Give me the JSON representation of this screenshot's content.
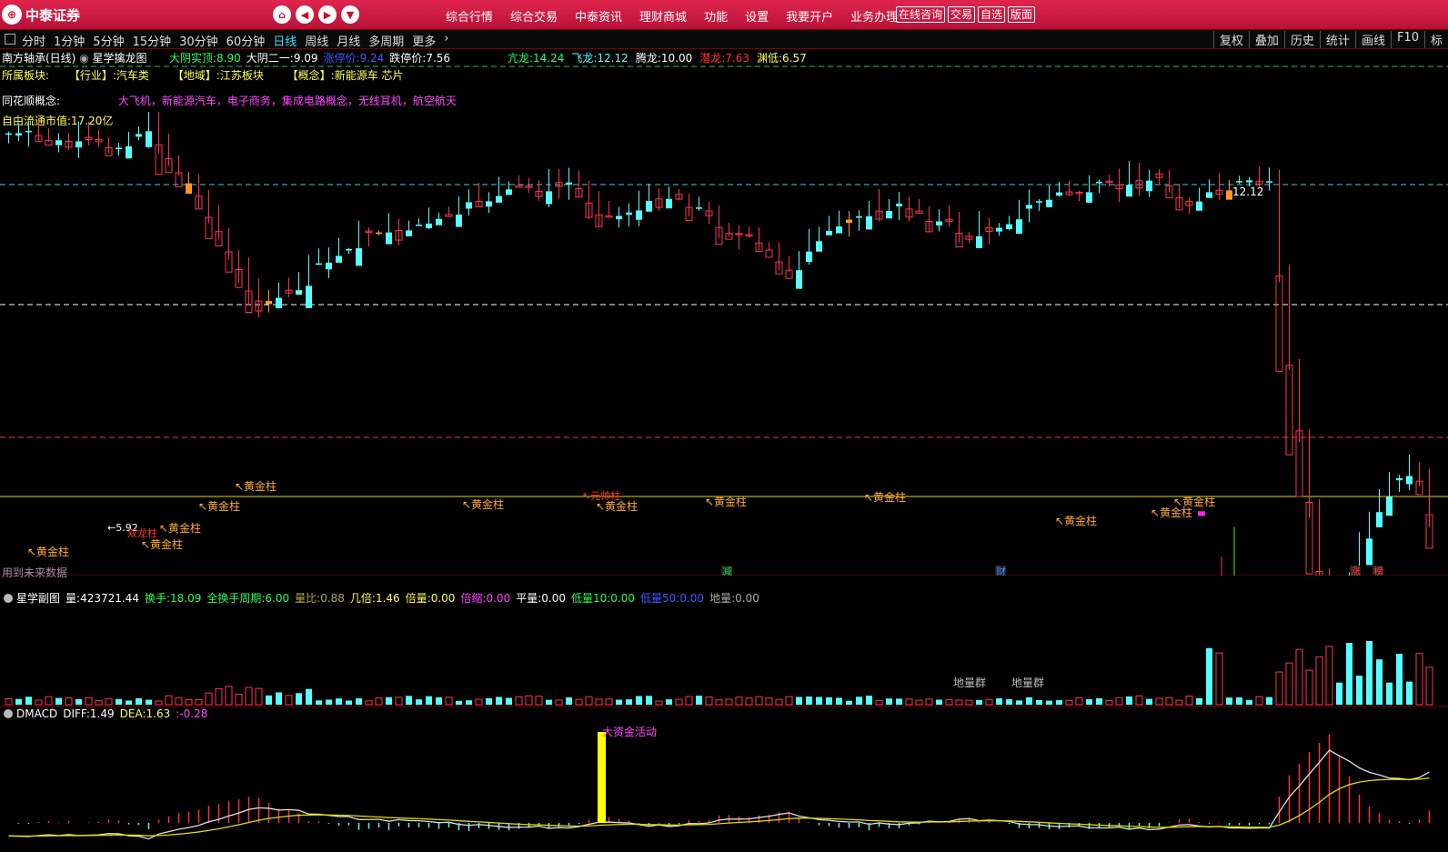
{
  "brand": "中泰证券",
  "nav_menu": [
    "综合行情",
    "综合交易",
    "中泰资讯",
    "理财商城",
    "功能",
    "设置",
    "我要开户",
    "业务办理"
  ],
  "top_buttons": [
    "在线咨询",
    "交易",
    "自选",
    "版面"
  ],
  "periods": [
    "分时",
    "1分钟",
    "5分钟",
    "15分钟",
    "30分钟",
    "60分钟",
    "日线",
    "周线",
    "月线",
    "多周期",
    "更多"
  ],
  "active_period": "日线",
  "right_tools": [
    "复权",
    "叠加",
    "历史",
    "统计",
    "画线",
    "F10",
    "标"
  ],
  "header": {
    "stock": "南方轴承(日线)",
    "indicator": "星学擒龙图",
    "items": [
      {
        "label": "大阴实顶:",
        "value": "8.90",
        "color": "green"
      },
      {
        "label": "大阴二一:",
        "value": "9.09",
        "color": "white"
      },
      {
        "label": "涨停价:",
        "value": "9.24",
        "color": "blue"
      },
      {
        "label": "跌停价:",
        "value": "7.56",
        "color": "white"
      }
    ],
    "dragons": [
      {
        "label": "亢龙:",
        "value": "14.24",
        "color": "green"
      },
      {
        "label": "飞龙:",
        "value": "12.12",
        "color": "cyan"
      },
      {
        "label": "腾龙:",
        "value": "10.00",
        "color": "white"
      },
      {
        "label": "潜龙:",
        "value": "7.63",
        "color": "red"
      },
      {
        "label": "渊低:",
        "value": "6.57",
        "color": "yellow"
      }
    ]
  },
  "sector": {
    "label": "所属板块:",
    "industry_label": "【行业】:",
    "industry": "汽车类",
    "region_label": "【地域】:",
    "region": "江苏板块",
    "concept_label": "【概念】:",
    "concept": "新能源车 芯片"
  },
  "ths": {
    "label": "同花顺概念:",
    "value": "大飞机，新能源汽车，电子商务，集成电路概念，无线耳机，航空航天"
  },
  "float_cap": {
    "label": "自由流通市值:",
    "value": "17.20亿"
  },
  "price_high_label": "12.12",
  "future_note": "用到未来数据",
  "signal_label": "黄金柱",
  "other_labels": [
    "元帅柱",
    "5.92",
    "双龙柱"
  ],
  "event_marks": [
    {
      "text": "减",
      "color": "#22cc44"
    },
    {
      "text": "财",
      "color": "#4488ff"
    },
    {
      "text": "涨",
      "color": "#ff3333"
    },
    {
      "text": "榜",
      "color": "#ff3333"
    }
  ],
  "volume_header": {
    "name": "星学副图",
    "items": [
      {
        "label": "量:",
        "value": "423721.44",
        "color": "white"
      },
      {
        "label": "换手:",
        "value": "18.09",
        "color": "green"
      },
      {
        "label": "全换手周期:",
        "value": "6.00",
        "color": "green"
      },
      {
        "label": "量比:",
        "value": "0.88",
        "color": "olive"
      },
      {
        "label": "几倍:",
        "value": "1.46",
        "color": "yellow"
      },
      {
        "label": "倍量:",
        "value": "0.00",
        "color": "yellow"
      },
      {
        "label": "倍缩:",
        "value": "0.00",
        "color": "magenta"
      },
      {
        "label": "平量:",
        "value": "0.00",
        "color": "white"
      },
      {
        "label": "低量10:",
        "value": "0.00",
        "color": "green"
      },
      {
        "label": "低量50:",
        "value": "0.00",
        "color": "blue"
      },
      {
        "label": "地量:",
        "value": "0.00",
        "color": "gray"
      }
    ],
    "ground_labels": [
      "地量群",
      "地量群"
    ]
  },
  "macd_header": {
    "name": "DMACD",
    "items": [
      {
        "label": "DIFF:",
        "value": "1.49",
        "color": "white"
      },
      {
        "label": "DEA:",
        "value": "1.63",
        "color": "yellow"
      },
      {
        "label": ":",
        "value": "-0.28",
        "color": "magenta"
      }
    ],
    "big_money": "大资金活动"
  },
  "colors": {
    "accent": "#c8102e",
    "up": "#ff3355",
    "down": "#55ffff"
  }
}
